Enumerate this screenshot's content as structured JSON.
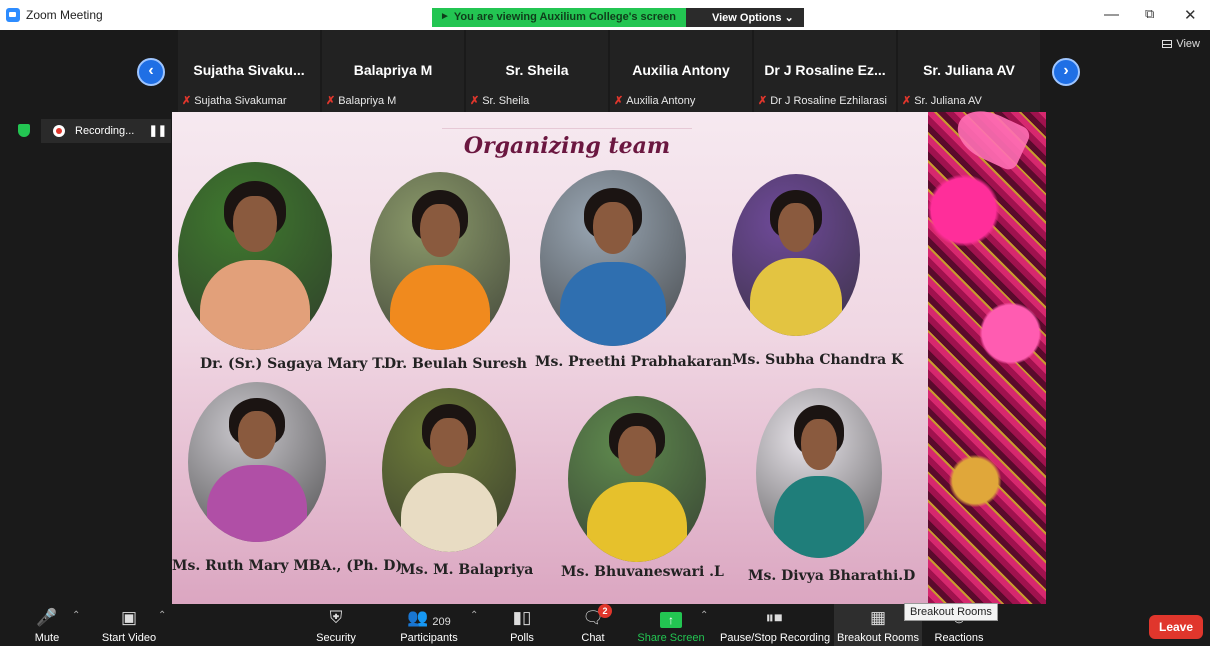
{
  "window": {
    "title": "Zoom Meeting"
  },
  "share_banner": {
    "text": "You are viewing Auxilium College's screen",
    "view_options": "View Options"
  },
  "gallery": {
    "participants": [
      {
        "name": "Sujatha  Sivaku...",
        "sub": "Sujatha Sivakumar"
      },
      {
        "name": "Balapriya M",
        "sub": "Balapriya M"
      },
      {
        "name": "Sr. Sheila",
        "sub": "Sr. Sheila"
      },
      {
        "name": "Auxilia Antony",
        "sub": "Auxilia Antony"
      },
      {
        "name": "Dr J Rosaline Ez...",
        "sub": "Dr J Rosaline Ezhilarasi"
      },
      {
        "name": "Sr. Juliana AV",
        "sub": "Sr. Juliana AV"
      }
    ],
    "view_label": "View"
  },
  "recording": {
    "label": "Recording..."
  },
  "slide": {
    "title": "Organizing team",
    "members": [
      {
        "name": "Dr. (Sr.) Sagaya Mary T.",
        "bg": "#3f7a2e",
        "saree": "#e2a07a"
      },
      {
        "name": "Dr. Beulah Suresh",
        "bg": "#8b9a6a",
        "saree": "#f08a1e"
      },
      {
        "name": "Ms. Preethi Prabhakaran",
        "bg": "#9aa7b4",
        "saree": "#2f6fb0"
      },
      {
        "name": "Ms. Subha Chandra K",
        "bg": "#6f4a9a",
        "saree": "#e3c441"
      },
      {
        "name": "Ms. Ruth Mary MBA., (Ph. D)",
        "bg": "#c9c7cc",
        "saree": "#b04fa6"
      },
      {
        "name": "Ms. M. Balapriya",
        "bg": "#6e7d3a",
        "saree": "#e8dcc3"
      },
      {
        "name": "Ms. Bhuvaneswari .L",
        "bg": "#5f8a4e",
        "saree": "#e6c12c"
      },
      {
        "name": "Ms. Divya Bharathi.D",
        "bg": "#e8e4ea",
        "saree": "#1f7e7a"
      }
    ]
  },
  "toolbar": {
    "mute": "Mute",
    "start_video": "Start Video",
    "security": "Security",
    "participants": "Participants",
    "participants_count": "209",
    "polls": "Polls",
    "chat": "Chat",
    "chat_badge": "2",
    "share_screen": "Share Screen",
    "pause_stop_recording": "Pause/Stop Recording",
    "breakout_rooms": "Breakout Rooms",
    "reactions": "Reactions",
    "tooltip": "Breakout Rooms",
    "leave": "Leave"
  },
  "colors": {
    "zoom_blue": "#2d8cff",
    "green": "#23c552",
    "leave_red": "#e0362c"
  }
}
